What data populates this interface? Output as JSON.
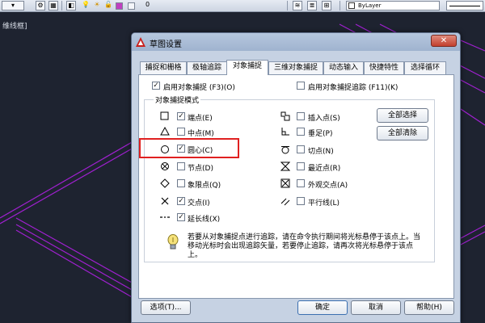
{
  "toolbar": {
    "layer_value": "0",
    "linetype_value": "ByLayer"
  },
  "viewport_label": "维线框]",
  "dialog": {
    "title": "草图设置",
    "close_label": "✕",
    "tabs": [
      {
        "label": "捕捉和栅格",
        "active": false
      },
      {
        "label": "极轴追踪",
        "active": false
      },
      {
        "label": "对象捕捉",
        "active": true
      },
      {
        "label": "三维对象捕捉",
        "active": false
      },
      {
        "label": "动态输入",
        "active": false
      },
      {
        "label": "快捷特性",
        "active": false
      },
      {
        "label": "选择循环",
        "active": false
      }
    ],
    "enable_osnap": {
      "label": "启用对象捕捉 (F3)(O)",
      "checked": true
    },
    "enable_tracking": {
      "label": "启用对象捕捉追踪 (F11)(K)",
      "checked": false
    },
    "group_title": "对象捕捉模式",
    "left_modes": [
      {
        "label": "端点(E)",
        "checked": true,
        "symbol": "square"
      },
      {
        "label": "中点(M)",
        "checked": false,
        "symbol": "triangle"
      },
      {
        "label": "圆心(C)",
        "checked": true,
        "symbol": "circle"
      },
      {
        "label": "节点(D)",
        "checked": false,
        "symbol": "node"
      },
      {
        "label": "象限点(Q)",
        "checked": false,
        "symbol": "diamond"
      },
      {
        "label": "交点(I)",
        "checked": true,
        "symbol": "cross"
      },
      {
        "label": "延长线(X)",
        "checked": true,
        "symbol": "extension"
      }
    ],
    "right_modes": [
      {
        "label": "插入点(S)",
        "checked": false,
        "symbol": "insertion"
      },
      {
        "label": "垂足(P)",
        "checked": false,
        "symbol": "perpendicular"
      },
      {
        "label": "切点(N)",
        "checked": false,
        "symbol": "tangent"
      },
      {
        "label": "最近点(R)",
        "checked": false,
        "symbol": "hourglass"
      },
      {
        "label": "外观交点(A)",
        "checked": false,
        "symbol": "apparent"
      },
      {
        "label": "平行线(L)",
        "checked": false,
        "symbol": "parallel"
      }
    ],
    "select_all_label": "全部选择",
    "clear_all_label": "全部清除",
    "tip_text": "若要从对象捕捉点进行追踪，请在命令执行期间将光标悬停于该点上。当移动光标时会出现追踪矢量，若要停止追踪，请再次将光标悬停于该点上。",
    "options_label": "选项(T)...",
    "ok_label": "确定",
    "cancel_label": "取消",
    "help_label": "帮助(H)"
  },
  "colors": {
    "cad_background": "#1e2330",
    "cad_lines": "#a020d0",
    "highlight": "#e02020"
  }
}
